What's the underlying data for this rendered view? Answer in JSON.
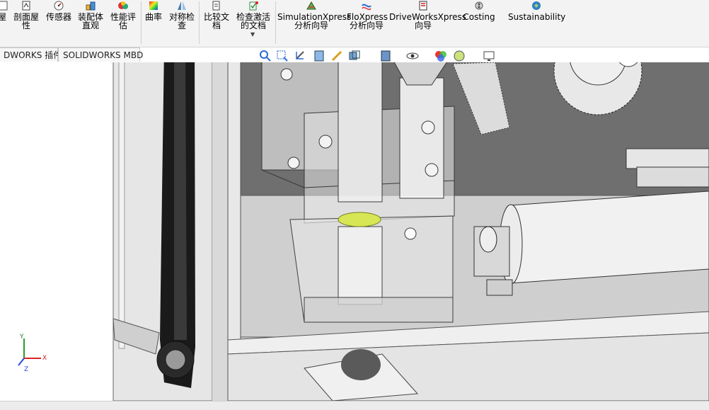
{
  "ribbon": {
    "items": [
      {
        "label": "屋",
        "icon": "property-icon"
      },
      {
        "label": "剖面屋\n性",
        "icon": "section-properties-icon"
      },
      {
        "label": "传感器",
        "icon": "sensor-icon"
      },
      {
        "label": "装配体\n直观",
        "icon": "assembly-visualization-icon"
      },
      {
        "label": "性能评\n估",
        "icon": "performance-evaluation-icon"
      },
      {
        "label": "曲率",
        "icon": "curvature-icon"
      },
      {
        "label": "对称检\n查",
        "icon": "symmetry-check-icon"
      },
      {
        "label": "比较文\n档",
        "icon": "compare-documents-icon"
      },
      {
        "label": "检查激活\n的文档",
        "icon": "check-active-document-icon"
      },
      {
        "label": "SimulationXpress\n分析向导",
        "icon": "simulationxpress-icon"
      },
      {
        "label": "FloXpress\n分析向导",
        "icon": "floxpress-icon"
      },
      {
        "label": "DriveWorksXpress\n向导",
        "icon": "driveworksxpress-icon"
      },
      {
        "label": "Costing",
        "icon": "costing-icon"
      },
      {
        "label": "Sustainability",
        "icon": "sustainability-icon"
      }
    ]
  },
  "tabs": [
    {
      "label": "DWORKS 插件"
    },
    {
      "label": "SOLIDWORKS MBD"
    }
  ],
  "triad": {
    "x": "X",
    "y": "Y",
    "z": "Z"
  },
  "colors": {
    "accent_yellow": "#d8e84a",
    "ribbon_bg": "#f3f3f3",
    "viewport_bg": "#ffffff"
  }
}
